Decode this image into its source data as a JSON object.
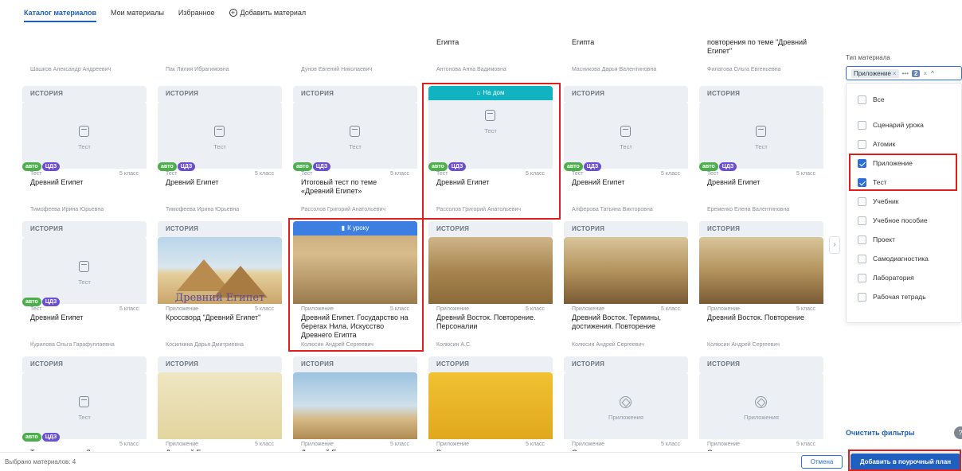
{
  "tabs": [
    {
      "label": "Каталог материалов"
    },
    {
      "label": "Мои материалы"
    },
    {
      "label": "Избранное"
    },
    {
      "label": "Добавить материал"
    }
  ],
  "top_row": [
    {
      "title": "",
      "author": "Шашков Александр Андреевич"
    },
    {
      "title": "",
      "author": "Пак Лилия Ибрагимовна"
    },
    {
      "title": "",
      "author": "Дунов Евгений Николаевич"
    },
    {
      "title": "Египта",
      "author": "Антонова Анна Вадимовна"
    },
    {
      "title": "Египта",
      "author": "Масникова Дарья Валентиновна"
    },
    {
      "title": "повторения по теме \"Древний Египет\"",
      "author": "Филатова Ольга Евгеньевна"
    }
  ],
  "row2": [
    {
      "subject": "ИСТОРИЯ",
      "cover_text": "Тест",
      "type": "Тест",
      "grade": "5 класс",
      "title": "Древний Египет",
      "author": "Тимофеева Ирина Юрьевна"
    },
    {
      "subject": "ИСТОРИЯ",
      "cover_text": "Тест",
      "type": "Тест",
      "grade": "5 класс",
      "title": "Древний Египет",
      "author": "Тимофеева Ирина Юрьевна"
    },
    {
      "subject": "ИСТОРИЯ",
      "cover_text": "Тест",
      "type": "Тест",
      "grade": "5 класс",
      "title": "Итоговый тест по теме «Древний Египет»",
      "author": "Рассолов Григорий Анатольевич"
    },
    {
      "banner": "На дом",
      "cover_text": "Тест",
      "type": "Тест",
      "grade": "5 класс",
      "title": "Древний Египет",
      "author": "Рассолов Григорий Анатольевич"
    },
    {
      "subject": "ИСТОРИЯ",
      "cover_text": "Тест",
      "type": "Тест",
      "grade": "5 класс",
      "title": "Древний Египет",
      "author": "Алферова Татьяна Викторовна"
    },
    {
      "subject": "ИСТОРИЯ",
      "cover_text": "Тест",
      "type": "Тест",
      "grade": "5 класс",
      "title": "Древний Египет",
      "author": "Еременко Елена Валентиновна"
    }
  ],
  "row3": [
    {
      "subject": "ИСТОРИЯ",
      "cover_text": "Тест",
      "type": "Тест",
      "grade": "5 класс",
      "title": "Древний Египет",
      "author": "Курилова Ольга Гарафуллаевна"
    },
    {
      "subject": "ИСТОРИЯ",
      "pic_label": "Древний Египет",
      "type": "Приложение",
      "grade": "5 класс",
      "title": "Кроссворд \"Древний Египет\"",
      "author": "Косилкина Дарья Дмитриевна"
    },
    {
      "banner": "К уроку",
      "type": "Приложение",
      "grade": "5 класс",
      "title": "Древний Египет. Государство на берегах Нила. Искусство Древнего Египта",
      "author": "Колюсин Андрей Сергеевич"
    },
    {
      "subject": "ИСТОРИЯ",
      "type": "Приложение",
      "grade": "5 класс",
      "title": "Древний Восток. Повторение. Персоналии",
      "author": "Колюсин А.С."
    },
    {
      "subject": "ИСТОРИЯ",
      "type": "Приложение",
      "grade": "5 класс",
      "title": "Древний Восток. Термины, достижения. Повторение",
      "author": "Колюсин Андрей Сергеевич"
    },
    {
      "subject": "ИСТОРИЯ",
      "type": "Приложение",
      "grade": "5 класс",
      "title": "Древний Восток. Повторение",
      "author": "Колюсин Андрей Сергеевич"
    }
  ],
  "row4": [
    {
      "subject": "ИСТОРИЯ",
      "cover_text": "Тест",
      "type": "",
      "grade": "5 класс",
      "title": "Тест по истории Древнего Востока"
    },
    {
      "subject": "ИСТОРИЯ",
      "type": "Приложение",
      "grade": "5 класс",
      "title": "Древний Египет"
    },
    {
      "subject": "ИСТОРИЯ",
      "type": "Приложение",
      "grade": "5 класс",
      "title": "Древний Египет"
    },
    {
      "subject": "ИСТОРИЯ",
      "type": "Приложение",
      "grade": "5 класс",
      "title": "Религия древних египтян"
    },
    {
      "subject": "ИСТОРИЯ",
      "cover_text": "Приложения",
      "type": "Приложение",
      "grade": "5 класс",
      "title": "Семь чудес света."
    },
    {
      "subject": "ИСТОРИЯ",
      "cover_text": "Приложения",
      "type": "Приложение",
      "grade": "5 класс",
      "title": "Семь чудес света"
    }
  ],
  "badges": {
    "auto": "авто",
    "cdz": "ЦДЗ"
  },
  "filter": {
    "label": "Тип материала",
    "chip": "Приложение",
    "chip_x": "×",
    "more": "•••",
    "count": "2",
    "clear_x": "×",
    "caret": "^",
    "options": [
      {
        "label": "Все",
        "checked": false
      },
      {
        "label": "Сценарий урока",
        "checked": false
      },
      {
        "label": "Атомик",
        "checked": false
      },
      {
        "label": "Приложение",
        "checked": true
      },
      {
        "label": "Тест",
        "checked": true
      },
      {
        "label": "Учебник",
        "checked": false
      },
      {
        "label": "Учебное пособие",
        "checked": false
      },
      {
        "label": "Проект",
        "checked": false
      },
      {
        "label": "Самодиагностика",
        "checked": false
      },
      {
        "label": "Лаборатория",
        "checked": false
      },
      {
        "label": "Рабочая тетрадь",
        "checked": false
      }
    ],
    "clear_filters": "Очистить фильтры",
    "help": "?"
  },
  "footer": {
    "selected": "Выбрано материалов: 4",
    "cancel": "Отмена",
    "add": "Добавить в поурочный план"
  },
  "scroll_arrow": "›",
  "colors": {
    "accent": "#1f5fbf",
    "banner_home": "#12b3c0",
    "banner_lesson": "#3d7fe0",
    "highlight": "#e01e1e",
    "badge_auto": "#4cae4c",
    "badge_cdz": "#6b4fd6"
  }
}
